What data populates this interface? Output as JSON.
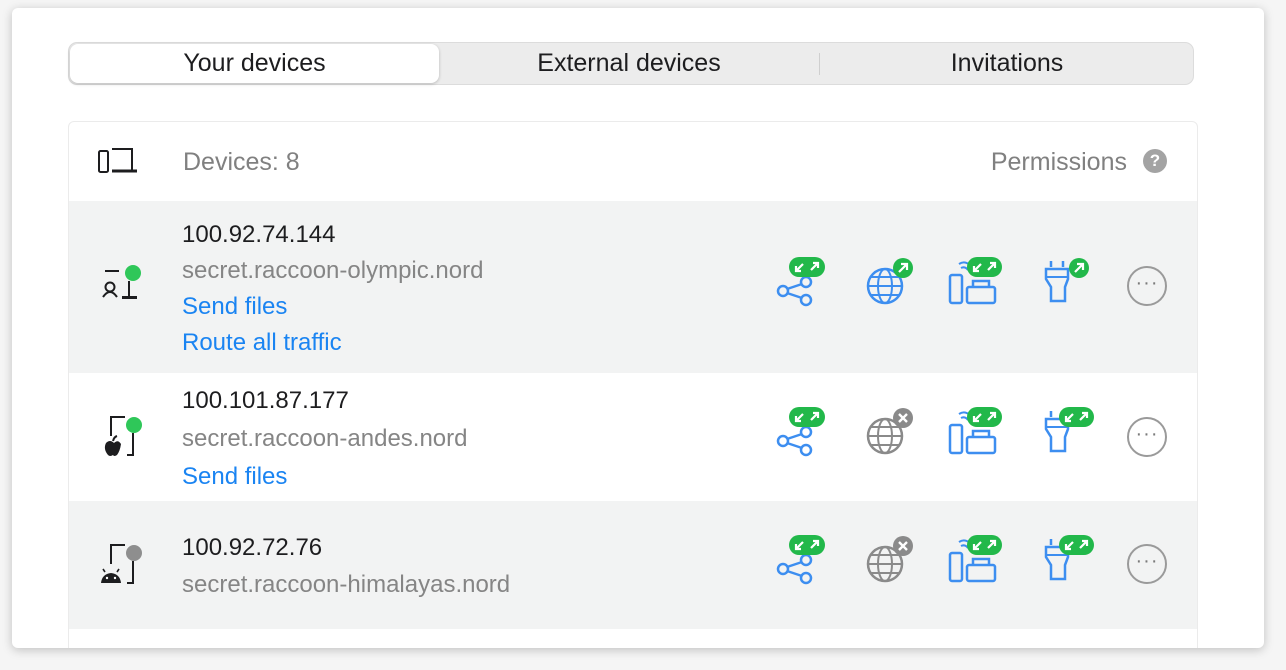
{
  "tabs": [
    {
      "label": "Your devices",
      "active": true
    },
    {
      "label": "External devices",
      "active": false
    },
    {
      "label": "Invitations",
      "active": false
    }
  ],
  "header": {
    "count_label": "Devices: 8",
    "permissions_label": "Permissions",
    "help_glyph": "?"
  },
  "devices": [
    {
      "ip": "100.92.74.144",
      "host": "secret.raccoon-olympic.nord",
      "links": [
        "Send files",
        "Route all traffic"
      ],
      "os": "linux",
      "status": "online",
      "permissions": {
        "file_sharing": "allowed",
        "routing": "allowed-outgoing",
        "local_network": "allowed",
        "traffic_routing": "allowed-outgoing"
      },
      "more_glyph": "···"
    },
    {
      "ip": "100.101.87.177",
      "host": "secret.raccoon-andes.nord",
      "links": [
        "Send files"
      ],
      "os": "apple",
      "status": "online",
      "permissions": {
        "file_sharing": "allowed",
        "routing": "blocked",
        "local_network": "allowed",
        "traffic_routing": "allowed"
      },
      "more_glyph": "···"
    },
    {
      "ip": "100.92.72.76",
      "host": "secret.raccoon-himalayas.nord",
      "links": [],
      "os": "android",
      "status": "offline",
      "permissions": {
        "file_sharing": "allowed",
        "routing": "blocked",
        "local_network": "allowed",
        "traffic_routing": "allowed"
      },
      "more_glyph": "···"
    }
  ],
  "colors": {
    "link": "#1a84f2",
    "icon_blue": "#3d8ef0",
    "badge_green": "#22b84a",
    "online": "#2fc759",
    "offline": "#8e8e8e",
    "blocked": "#8a8a8a"
  }
}
